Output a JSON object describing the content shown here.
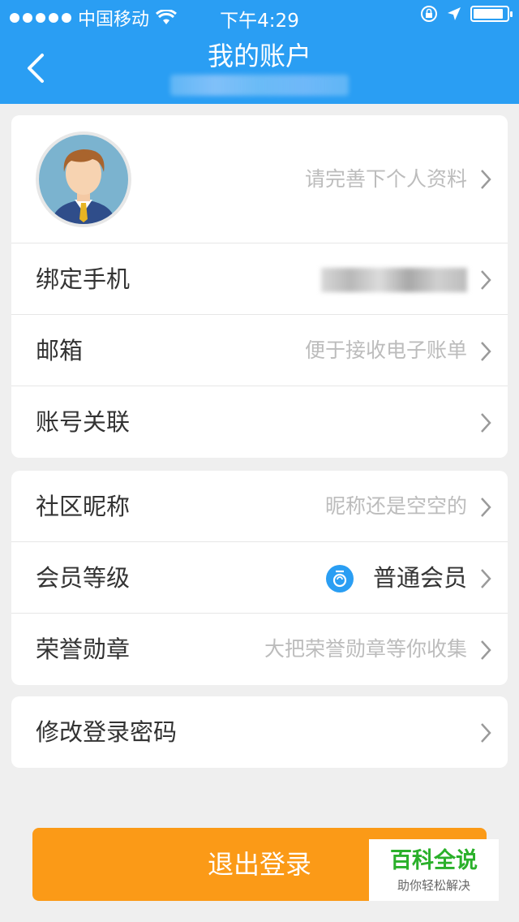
{
  "status_bar": {
    "carrier": "中国移动",
    "time": "下午4:29"
  },
  "header": {
    "title": "我的账户"
  },
  "profile": {
    "hint": "请完善下个人资料"
  },
  "group1": [
    {
      "label": "绑定手机",
      "hint": ""
    },
    {
      "label": "邮箱",
      "hint": "便于接收电子账单"
    },
    {
      "label": "账号关联",
      "hint": ""
    }
  ],
  "group2": [
    {
      "label": "社区昵称",
      "hint": "昵称还是空空的"
    },
    {
      "label": "会员等级",
      "value": "普通会员"
    },
    {
      "label": "荣誉勋章",
      "hint": "大把荣誉勋章等你收集"
    }
  ],
  "group3": [
    {
      "label": "修改登录密码"
    }
  ],
  "logout_label": "退出登录",
  "watermark": {
    "title": "百科全说",
    "subtitle": "助你轻松解决"
  },
  "colors": {
    "header_bg": "#2a9ef3",
    "page_bg": "#efefef",
    "logout_bg": "#fb9a17",
    "badge": "#2a9ef3"
  }
}
